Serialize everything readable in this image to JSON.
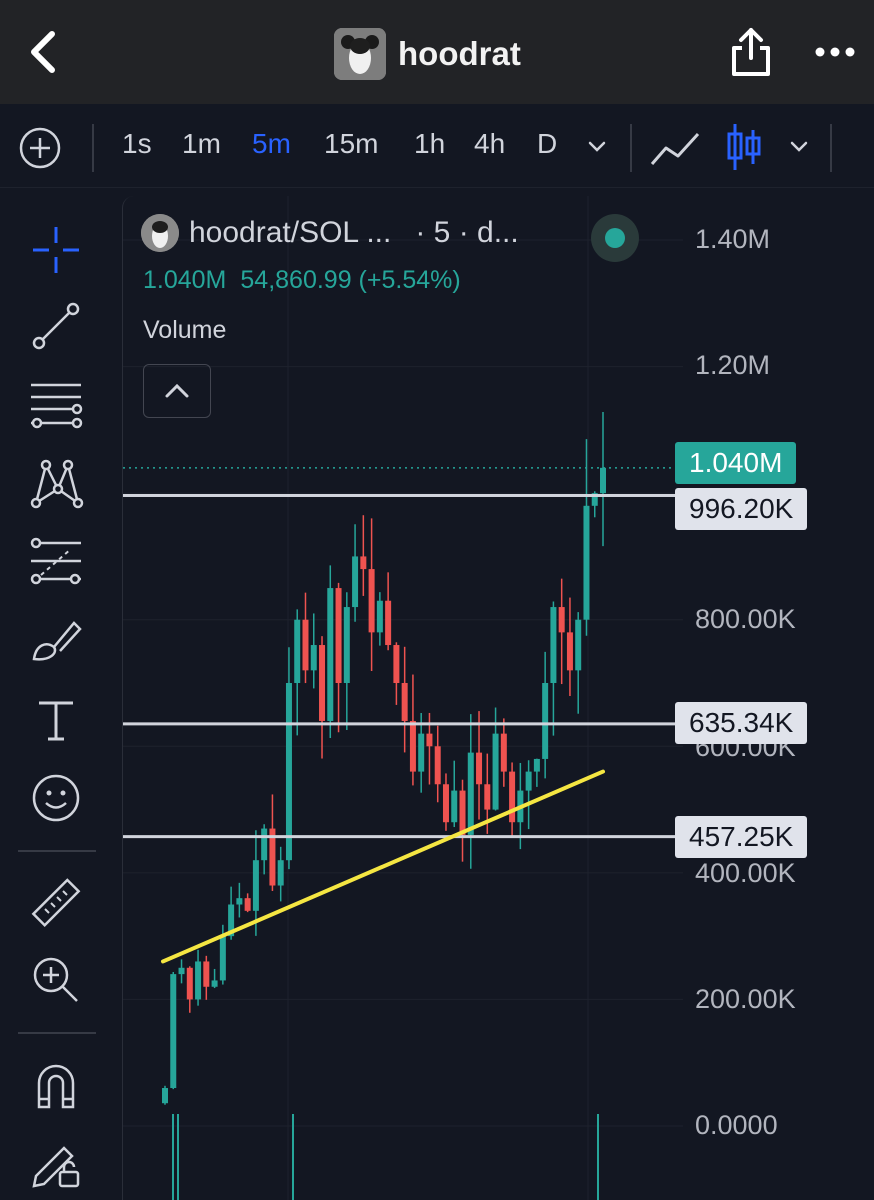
{
  "header": {
    "title": "hoodrat"
  },
  "toolbar": {
    "timeframes": [
      {
        "label": "1s",
        "active": false
      },
      {
        "label": "1m",
        "active": false
      },
      {
        "label": "5m",
        "active": true
      },
      {
        "label": "15m",
        "active": false
      },
      {
        "label": "1h",
        "active": false
      },
      {
        "label": "4h",
        "active": false
      },
      {
        "label": "D",
        "active": false
      }
    ],
    "accent_color": "#2962ff"
  },
  "sidebar": {
    "tools": [
      "crosshair-icon",
      "trend-line-icon",
      "horizontal-lines-icon",
      "pattern-icon",
      "fib-icon",
      "brush-icon",
      "text-icon",
      "emoji-icon",
      "ruler-icon",
      "zoom-in-icon",
      "magnet-icon",
      "lock-drawings-icon"
    ]
  },
  "legend": {
    "symbol": "hoodrat/SOL ...",
    "interval": "· 5 · d...",
    "price": "1.040M",
    "change": "54,860.99 (+5.54%)",
    "volume_label": "Volume"
  },
  "axis": {
    "labels": [
      "1.40M",
      "1.20M",
      "800.00K",
      "600.00K",
      "400.00K",
      "200.00K",
      "0.0000"
    ]
  },
  "tags": {
    "current": "1.040M",
    "level1": "996.20K",
    "level2": "635.34K",
    "level3": "457.25K"
  },
  "colors": {
    "up": "#26a69a",
    "down": "#ef5350",
    "trendline": "#f5e642",
    "level_line": "#d1d4dc"
  },
  "chart_data": {
    "type": "candlestick",
    "symbol": "hoodrat/SOL",
    "interval": "5m",
    "ylim": [
      0,
      1400000
    ],
    "horizontal_levels": [
      996200,
      635340,
      457250
    ],
    "current_price": 1040000,
    "trendline": {
      "from": 260000,
      "to": 560000
    },
    "closes": [
      60000,
      240000,
      250000,
      200000,
      260000,
      220000,
      230000,
      300000,
      350000,
      360000,
      340000,
      420000,
      470000,
      380000,
      420000,
      700000,
      800000,
      720000,
      760000,
      640000,
      850000,
      700000,
      820000,
      900000,
      880000,
      780000,
      830000,
      760000,
      700000,
      640000,
      560000,
      620000,
      600000,
      540000,
      480000,
      530000,
      460000,
      590000,
      540000,
      500000,
      620000,
      560000,
      480000,
      530000,
      560000,
      580000,
      700000,
      820000,
      780000,
      720000,
      800000,
      980000,
      1000000,
      1040000
    ]
  }
}
